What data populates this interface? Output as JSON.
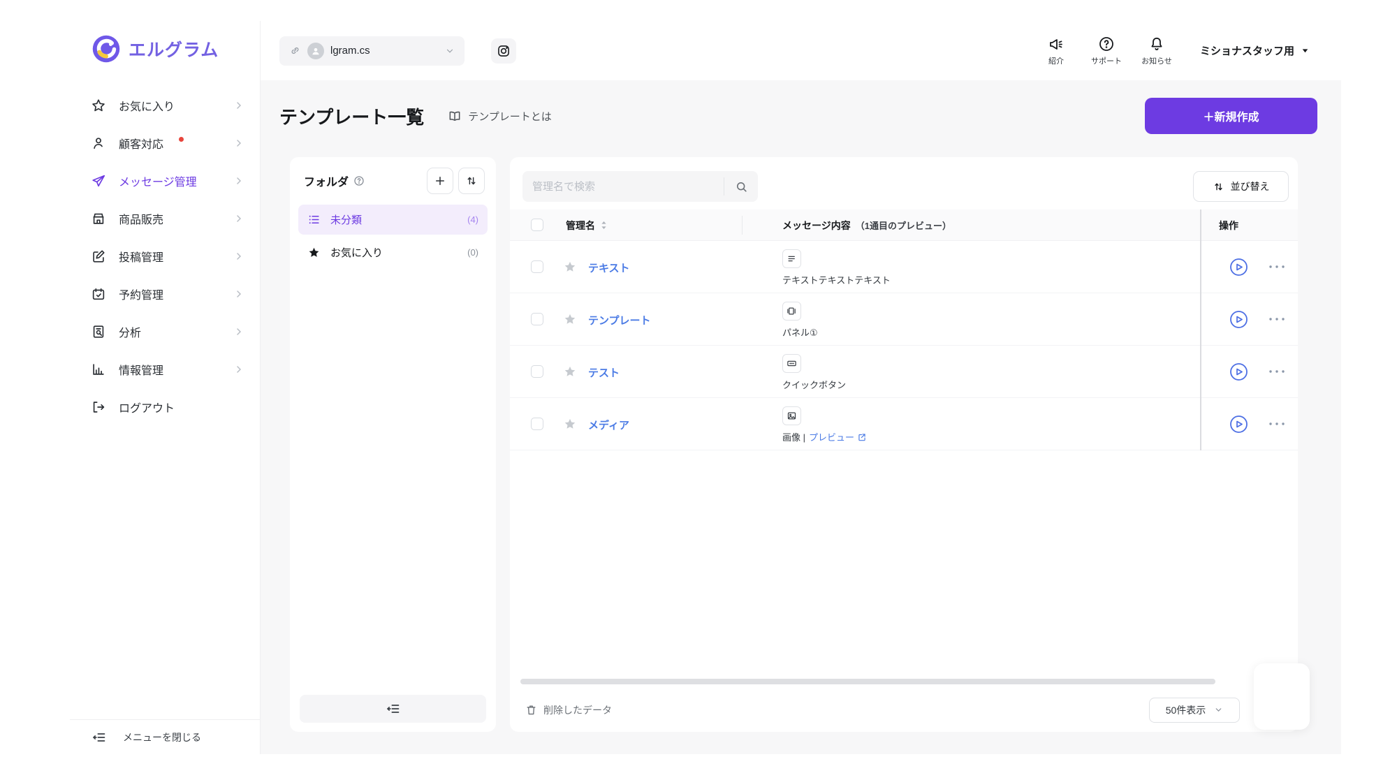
{
  "brand": {
    "name": "エルグラム"
  },
  "colors": {
    "accent": "#6D3BE2",
    "logo_purple": "#7361E2",
    "link_blue": "#4B7BE5",
    "active_folder_bg": "#F3EDFC",
    "badge_red": "#E8453C",
    "main_bg": "#F7F7F8"
  },
  "topbar": {
    "account": {
      "value": "lgram.cs",
      "icons": [
        "link-icon",
        "avatar",
        "chevron-down-icon"
      ]
    },
    "instagram_icon": "instagram-icon",
    "actions": [
      {
        "label": "紹介",
        "icon": "megaphone-icon"
      },
      {
        "label": "サポート",
        "icon": "help-circle-icon"
      },
      {
        "label": "お知らせ",
        "icon": "bell-icon"
      }
    ],
    "profile": {
      "label": "ミショナスタッフ用",
      "icon": "caret-down-icon"
    }
  },
  "sidebar": {
    "items": [
      {
        "label": "お気に入り",
        "icon": "star-outline-icon",
        "chevron": true
      },
      {
        "label": "顧客対応",
        "icon": "person-icon",
        "chevron": true,
        "dot": true
      },
      {
        "label": "メッセージ管理",
        "icon": "send-icon",
        "chevron": true,
        "active": true
      },
      {
        "label": "商品販売",
        "icon": "store-icon",
        "chevron": true
      },
      {
        "label": "投稿管理",
        "icon": "edit-icon",
        "chevron": true
      },
      {
        "label": "予約管理",
        "icon": "calendar-icon",
        "chevron": true
      },
      {
        "label": "分析",
        "icon": "doc-search-icon",
        "chevron": true
      },
      {
        "label": "情報管理",
        "icon": "bar-chart-icon",
        "chevron": true
      },
      {
        "label": "ログアウト",
        "icon": "logout-icon",
        "chevron": false
      }
    ],
    "collapse": {
      "label": "メニューを閉じる",
      "icon": "collapse-menu-icon"
    }
  },
  "page": {
    "title": "テンプレート一覧",
    "help": {
      "label": "テンプレートとは",
      "icon": "book-icon"
    },
    "create_button": "＋新規作成"
  },
  "folders": {
    "title": "フォルダ",
    "items": [
      {
        "label": "未分類",
        "count": "(4)",
        "icon": "list-icon",
        "active": true
      },
      {
        "label": "お気に入り",
        "count": "(0)",
        "icon": "star-filled-icon",
        "active": false
      }
    ]
  },
  "table": {
    "search": {
      "placeholder": "管理名で検索",
      "icon": "search-icon"
    },
    "sort_button": "並び替え",
    "columns": {
      "name": "管理名",
      "message": "メッセージ内容",
      "message_note": "（1通目のプレビュー）",
      "actions": "操作"
    },
    "rows": [
      {
        "name": "テキスト",
        "type_icon": "text-message-icon",
        "preview": "テキストテキストテキスト"
      },
      {
        "name": "テンプレート",
        "type_icon": "panel-icon",
        "preview": "パネル①"
      },
      {
        "name": "テスト",
        "type_icon": "quick-button-icon",
        "preview": "クイックボタン"
      },
      {
        "name": "メディア",
        "type_icon": "image-icon",
        "preview_prefix": "画像 |",
        "preview_link": "プレビュー"
      }
    ],
    "footer": {
      "deleted_label": "削除したデータ",
      "page_size": "50件表示"
    }
  }
}
